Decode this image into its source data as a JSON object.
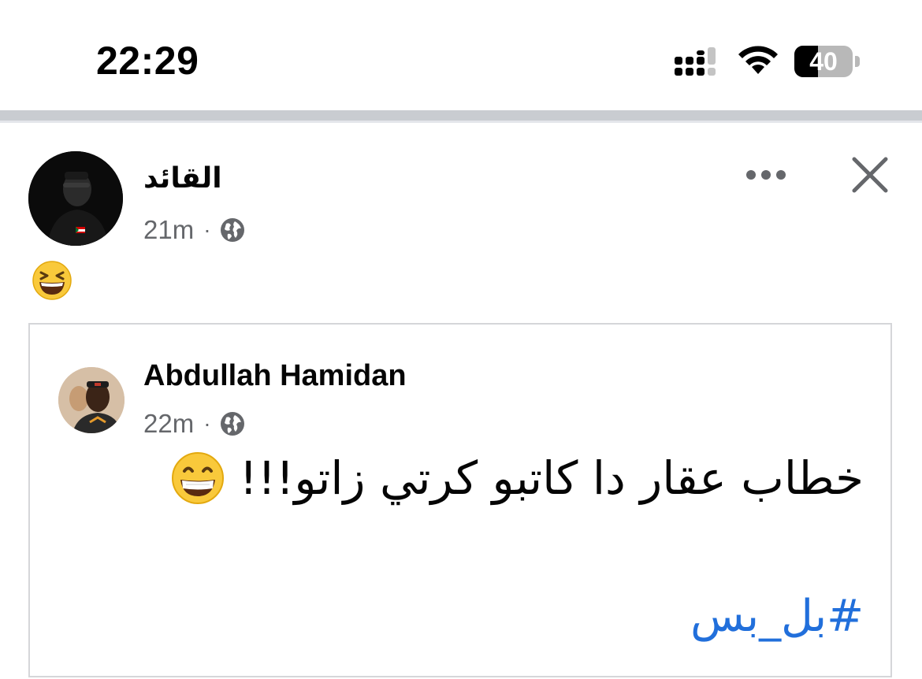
{
  "status_bar": {
    "time": "22:29",
    "battery_level": "40",
    "battery_fraction": 0.4
  },
  "post": {
    "author": "القائد",
    "time": "21m",
    "separator": "·",
    "privacy_icon": "globe-icon",
    "more_icon": "more-icon",
    "close_icon": "close-icon",
    "reaction_emoji": "laughing-face-emoji"
  },
  "shared_post": {
    "author": "Abdullah Hamidan",
    "time": "22m",
    "separator": "·",
    "privacy_icon": "globe-icon",
    "text": "خطاب عقار دا كاتبو كرتي زاتو!!!",
    "text_emoji": "grinning-face-emoji",
    "hashtag": "#بل_بس"
  },
  "colors": {
    "hashtag": "#216fdb",
    "meta_text": "#65676b",
    "separator": "#c9ccd1"
  }
}
